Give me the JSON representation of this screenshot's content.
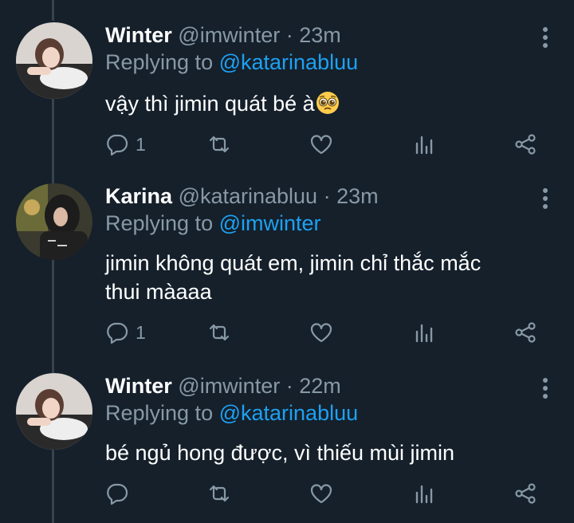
{
  "tweets": [
    {
      "name": "Winter",
      "handle": "@imwinter",
      "time": "· 23m",
      "replying_prefix": "Replying to",
      "replying_to": "@katarinabluu",
      "text": "vậy thì jimin quát bé à",
      "emoji": "pleading-face",
      "reply_count": "1"
    },
    {
      "name": "Karina",
      "handle": "@katarinabluu",
      "time": "· 23m",
      "replying_prefix": "Replying to",
      "replying_to": "@imwinter",
      "text_line1": "jimin không quát em, jimin chỉ thắc mắc",
      "text_line2": "thui màaaa",
      "reply_count": "1"
    },
    {
      "name": "Winter",
      "handle": "@imwinter",
      "time": "· 22m",
      "replying_prefix": "Replying to",
      "replying_to": "@katarinabluu",
      "text": "bé ngủ hong được, vì thiếu mùi jimin",
      "reply_count": ""
    }
  ],
  "colors": {
    "background": "#15202b",
    "text": "#ffffff",
    "muted": "#8899a6",
    "link": "#1da1f2",
    "thread_line": "#38444d"
  },
  "icons": [
    "reply-icon",
    "retweet-icon",
    "like-icon",
    "analytics-icon",
    "share-icon",
    "more-options-icon"
  ]
}
